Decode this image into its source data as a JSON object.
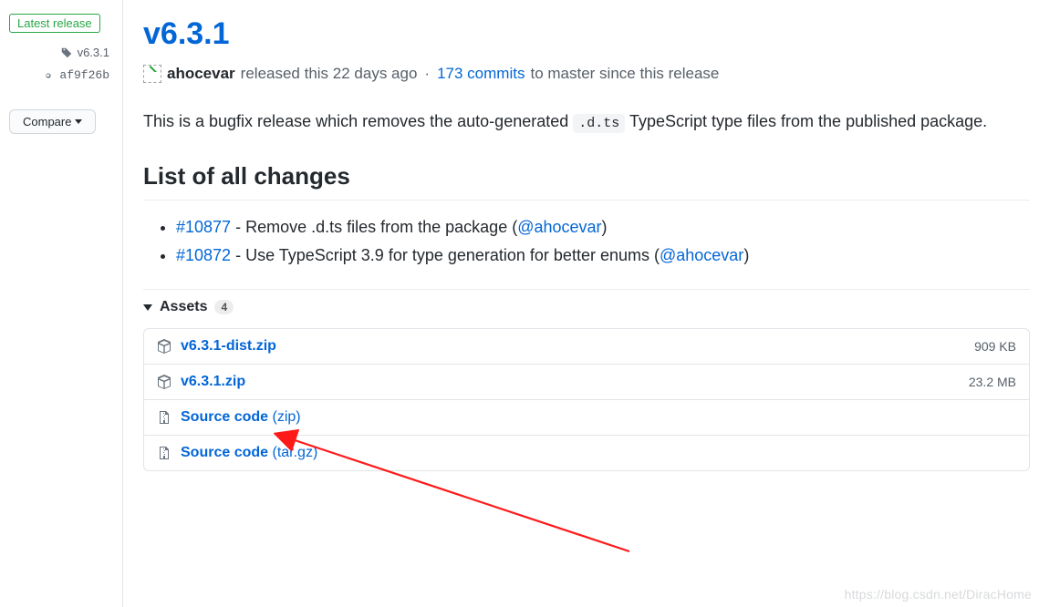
{
  "sidebar": {
    "latest_release_label": "Latest release",
    "tag": "v6.3.1",
    "commit": "af9f26b",
    "compare_label": "Compare"
  },
  "release": {
    "title": "v6.3.1",
    "author": "ahocevar",
    "released_text": "released this 22 days ago",
    "commits_link": "173 commits",
    "commits_suffix": "to master since this release",
    "description_pre": "This is a bugfix release which removes the auto-generated ",
    "description_code": ".d.ts",
    "description_post": " TypeScript type files from the published package."
  },
  "changes_heading": "List of all changes",
  "changes": [
    {
      "issue": "#10877",
      "text": " - Remove .d.ts files from the package (",
      "user": "@ahocevar",
      "tail": ")"
    },
    {
      "issue": "#10872",
      "text": " - Use TypeScript 3.9 for type generation for better enums (",
      "user": "@ahocevar",
      "tail": ")"
    }
  ],
  "assets": {
    "label": "Assets",
    "count": "4",
    "items": [
      {
        "icon": "package",
        "name": "v6.3.1-dist.zip",
        "ext": "",
        "size": "909 KB"
      },
      {
        "icon": "package",
        "name": "v6.3.1.zip",
        "ext": "",
        "size": "23.2 MB"
      },
      {
        "icon": "zip",
        "name": "Source code",
        "ext": "(zip)",
        "size": ""
      },
      {
        "icon": "zip",
        "name": "Source code",
        "ext": "(tar.gz)",
        "size": ""
      }
    ]
  },
  "watermark": "https://blog.csdn.net/DiracHome"
}
